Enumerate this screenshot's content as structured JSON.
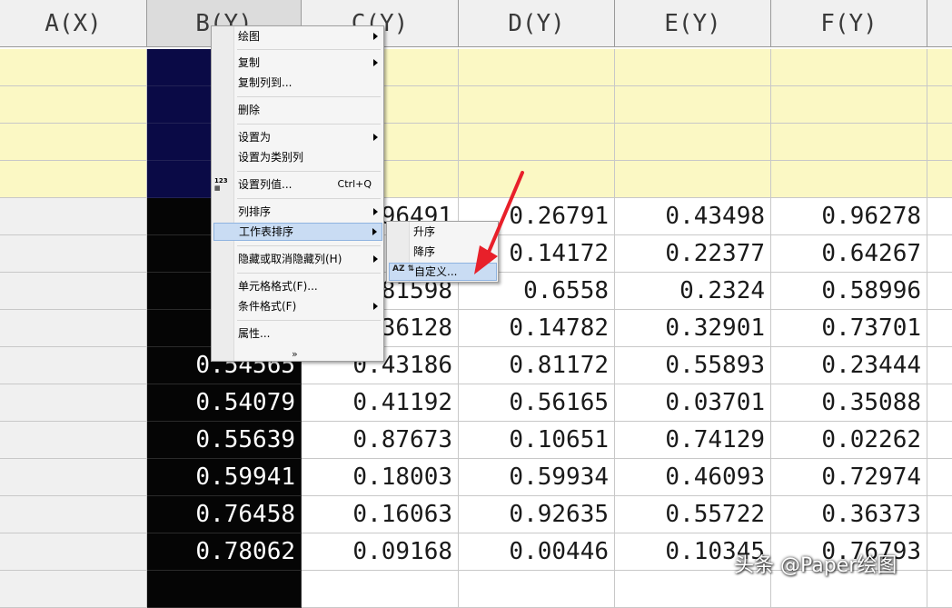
{
  "sheet": {
    "columns": [
      {
        "label": "A(X)",
        "selected": false
      },
      {
        "label": "B(Y)",
        "selected": true
      },
      {
        "label": "C(Y)",
        "selected": false
      },
      {
        "label": "D(Y)",
        "selected": false
      },
      {
        "label": "E(Y)",
        "selected": false
      },
      {
        "label": "F(Y)",
        "selected": false
      }
    ],
    "rows": [
      [
        "",
        "0.",
        "0.96491",
        "0.26791",
        "0.43498",
        "0.96278"
      ],
      [
        "",
        "0.",
        "0.",
        "0.14172",
        "0.22377",
        "0.64267"
      ],
      [
        "",
        "0.",
        "0.81598",
        "0.6558",
        "0.2324",
        "0.58996"
      ],
      [
        "",
        "0.",
        "0.36128",
        "0.14782",
        "0.32901",
        "0.73701"
      ],
      [
        "",
        "0.54565",
        "0.43186",
        "0.81172",
        "0.55893",
        "0.23444"
      ],
      [
        "",
        "0.54079",
        "0.41192",
        "0.56165",
        "0.03701",
        "0.35088"
      ],
      [
        "",
        "0.55639",
        "0.87673",
        "0.10651",
        "0.74129",
        "0.02262"
      ],
      [
        "",
        "0.59941",
        "0.18003",
        "0.59934",
        "0.46093",
        "0.72974"
      ],
      [
        "",
        "0.76458",
        "0.16063",
        "0.92635",
        "0.55722",
        "0.36373"
      ],
      [
        "",
        "0.78062",
        "0.09168",
        "0.00446",
        "0.10345",
        "0.76793"
      ]
    ]
  },
  "context_menu": {
    "items": [
      {
        "label": "绘图",
        "submenu": true
      },
      {
        "label": "复制",
        "submenu": true
      },
      {
        "label": "复制列到..."
      },
      {
        "label": "删除"
      },
      {
        "label": "设置为",
        "submenu": true
      },
      {
        "label": "设置为类别列"
      },
      {
        "label": "设置列值...",
        "shortcut": "Ctrl+Q",
        "icon": "123-icon"
      },
      {
        "label": "列排序",
        "submenu": true
      },
      {
        "label": "工作表排序",
        "submenu": true,
        "highlighted": true
      },
      {
        "label": "隐藏或取消隐藏列(H)",
        "submenu": true
      },
      {
        "label": "单元格格式(F)..."
      },
      {
        "label": "条件格式(F)",
        "submenu": true
      },
      {
        "label": "属性..."
      }
    ],
    "more_glyph": "»"
  },
  "submenu": {
    "items": [
      {
        "label": "升序"
      },
      {
        "label": "降序"
      },
      {
        "label": "自定义...",
        "highlighted": true,
        "icon": "sort-az-icon"
      }
    ]
  },
  "icon_text": {
    "set_values": "123",
    "sort": "AZ"
  },
  "annotation": {
    "arrow_color": "#e8202a"
  },
  "watermark": {
    "text": "头条 @Paper绘图"
  },
  "colors": {
    "meta_row": "#fbf8c4",
    "selected_meta": "#0a0a46",
    "selected_cell": "#050505",
    "menu_highlight": "#c9dcf3"
  }
}
